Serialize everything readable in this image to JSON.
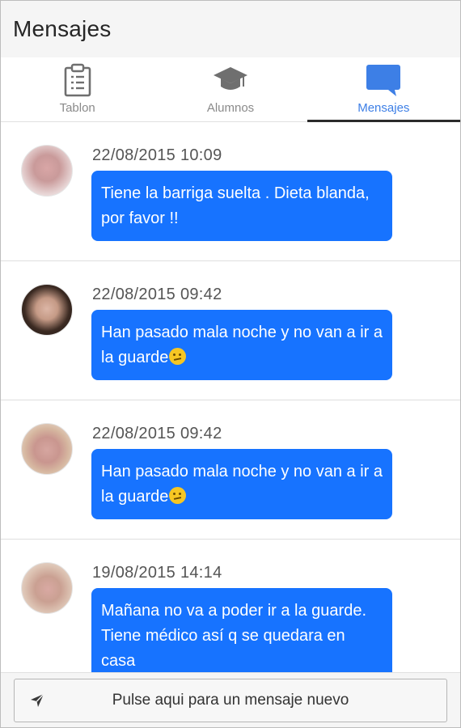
{
  "header": {
    "title": "Mensajes"
  },
  "tabs": [
    {
      "label": "Tablon",
      "icon": "clipboard-icon",
      "active": false
    },
    {
      "label": "Alumnos",
      "icon": "graduation-cap-icon",
      "active": false
    },
    {
      "label": "Mensajes",
      "icon": "chat-bubble-icon",
      "active": true
    }
  ],
  "colors": {
    "accent": "#1773ff",
    "active_tab": "#3d7fe6",
    "header_bg": "#f5f5f5"
  },
  "messages": [
    {
      "timestamp": "22/08/2015 10:09",
      "text": "Tiene la barriga suelta . Dieta blanda, por favor !!",
      "emoji": false
    },
    {
      "timestamp": "22/08/2015 09:42",
      "text": "Han pasado mala noche y no van a ir a la guarde",
      "emoji": true
    },
    {
      "timestamp": "22/08/2015 09:42",
      "text": "Han pasado mala noche y no van a ir a la guarde",
      "emoji": true
    },
    {
      "timestamp": "19/08/2015 14:14",
      "text": "Mañana no va a poder ir a la guarde. Tiene médico así q se quedara en casa",
      "emoji": false
    }
  ],
  "compose": {
    "label": "Pulse aqui para un mensaje nuevo",
    "icon": "send-icon"
  }
}
